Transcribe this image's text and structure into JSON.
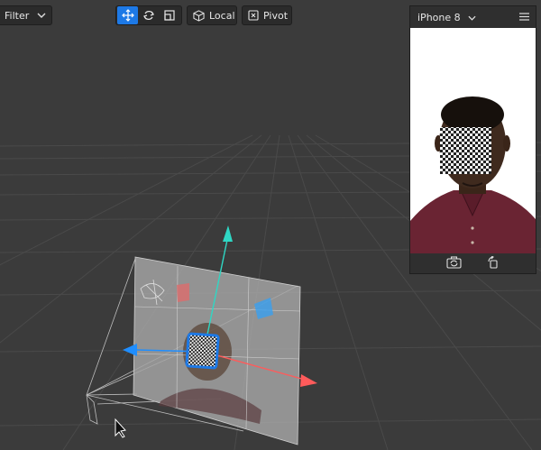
{
  "toolbar": {
    "filter_label": "Filter",
    "local_label": "Local",
    "pivot_label": "Pivot",
    "tools": [
      "move-tool",
      "rotate-tool",
      "scale-tool"
    ]
  },
  "preview": {
    "device_label": "iPhone 8"
  },
  "colors": {
    "accent": "#1d79e6",
    "axis_x": "#ff5b5b",
    "axis_y": "#2fd7c4",
    "axis_z": "#1f8eff",
    "background": "#3b3b3b"
  }
}
